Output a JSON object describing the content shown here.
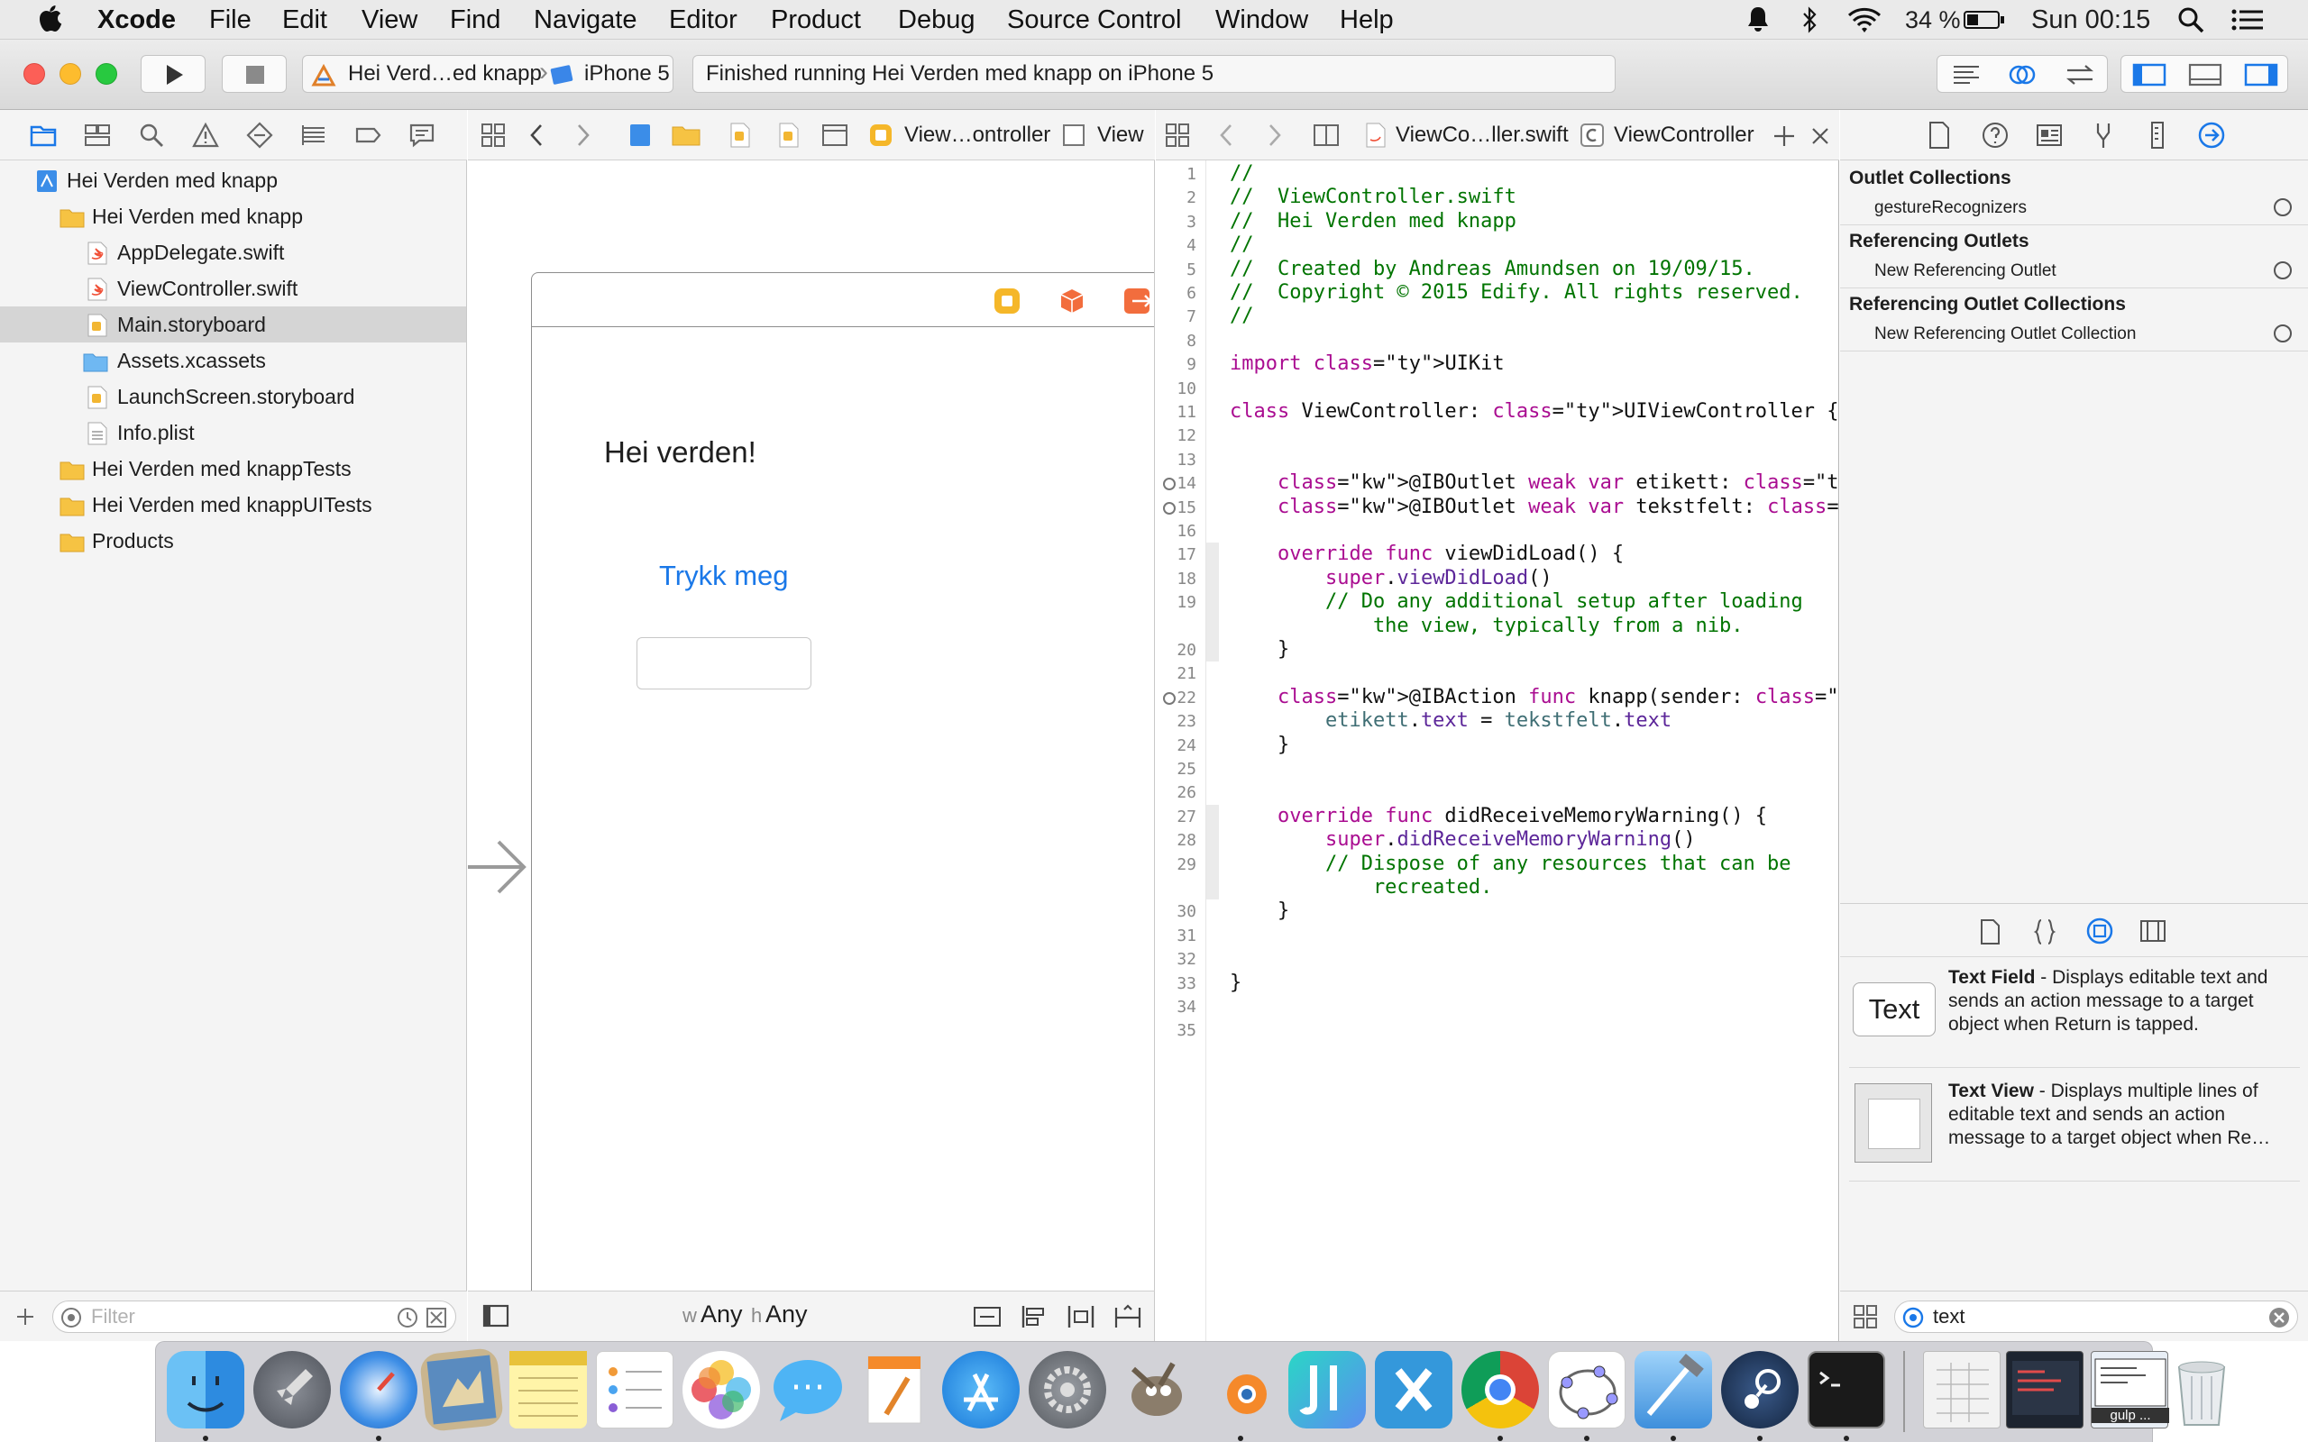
{
  "menubar": {
    "app_name": "Xcode",
    "items": [
      "File",
      "Edit",
      "View",
      "Find",
      "Navigate",
      "Editor",
      "Product",
      "Debug",
      "Source Control",
      "Window",
      "Help"
    ],
    "battery": "34 %",
    "clock": "Sun 00:15"
  },
  "toolbar": {
    "scheme_project": "Hei Verd…ed knapp",
    "scheme_device": "iPhone 5",
    "activity": "Finished running Hei Verden med knapp on iPhone 5"
  },
  "navigator": {
    "tree": [
      {
        "label": "Hei Verden med knapp",
        "icon": "project-icon"
      },
      {
        "label": "Hei Verden med knapp",
        "icon": "folder-icon"
      },
      {
        "label": "AppDelegate.swift",
        "icon": "swift-file-icon"
      },
      {
        "label": "ViewController.swift",
        "icon": "swift-file-icon"
      },
      {
        "label": "Main.storyboard",
        "icon": "storyboard-icon"
      },
      {
        "label": "Assets.xcassets",
        "icon": "assets-folder-icon"
      },
      {
        "label": "LaunchScreen.storyboard",
        "icon": "storyboard-icon"
      },
      {
        "label": "Info.plist",
        "icon": "plist-icon"
      },
      {
        "label": "Hei Verden med knappTests",
        "icon": "folder-icon"
      },
      {
        "label": "Hei Verden med knappUITests",
        "icon": "folder-icon"
      },
      {
        "label": "Products",
        "icon": "folder-icon"
      }
    ],
    "filter_placeholder": "Filter"
  },
  "storyboard": {
    "jump_scene": "View…ontroller",
    "jump_view": "View",
    "label_text": "Hei verden!",
    "button_text": "Trykk meg",
    "size_w_prefix": "w",
    "size_w": "Any",
    "size_h_prefix": "h",
    "size_h": "Any"
  },
  "editor": {
    "jump_file": "ViewCo…ller.swift",
    "jump_symbol": "ViewController",
    "line_numbers": [
      1,
      2,
      3,
      4,
      5,
      6,
      7,
      8,
      9,
      10,
      11,
      12,
      13,
      14,
      15,
      16,
      17,
      18,
      19,
      "",
      20,
      21,
      22,
      23,
      24,
      25,
      26,
      27,
      28,
      29,
      "",
      30,
      31,
      32,
      33,
      34,
      35
    ],
    "lines": [
      {
        "t": "//",
        "c": "cm"
      },
      {
        "t": "//  ViewController.swift",
        "c": "cm"
      },
      {
        "t": "//  Hei Verden med knapp",
        "c": "cm"
      },
      {
        "t": "//",
        "c": "cm"
      },
      {
        "t": "//  Created by Andreas Amundsen on 19/09/15.",
        "c": "cm"
      },
      {
        "t": "//  Copyright © 2015 Edify. All rights reserved.",
        "c": "cm"
      },
      {
        "t": "//",
        "c": "cm"
      },
      {
        "t": "",
        "c": ""
      },
      {
        "t": "import UIKit",
        "c": "import"
      },
      {
        "t": "",
        "c": ""
      },
      {
        "t": "class ViewController: UIViewController {",
        "c": "class"
      },
      {
        "t": "",
        "c": ""
      },
      {
        "t": "",
        "c": ""
      },
      {
        "t": "    @IBOutlet weak var etikett: UILabel!",
        "c": "outlet1"
      },
      {
        "t": "    @IBOutlet weak var tekstfelt: UITextField!",
        "c": "outlet2"
      },
      {
        "t": "",
        "c": ""
      },
      {
        "t": "    override func viewDidLoad() {",
        "c": "func1"
      },
      {
        "t": "        super.viewDidLoad()",
        "c": "super1"
      },
      {
        "t": "        // Do any additional setup after loading",
        "c": "cm"
      },
      {
        "t": "            the view, typically from a nib.",
        "c": "cm"
      },
      {
        "t": "    }",
        "c": ""
      },
      {
        "t": "",
        "c": ""
      },
      {
        "t": "    @IBAction func knapp(sender: AnyObject) {",
        "c": "action"
      },
      {
        "t": "        etikett.text = tekstfelt.text",
        "c": "assign"
      },
      {
        "t": "    }",
        "c": ""
      },
      {
        "t": "",
        "c": ""
      },
      {
        "t": "",
        "c": ""
      },
      {
        "t": "    override func didReceiveMemoryWarning() {",
        "c": "func2"
      },
      {
        "t": "        super.didReceiveMemoryWarning()",
        "c": "super2"
      },
      {
        "t": "        // Dispose of any resources that can be",
        "c": "cm"
      },
      {
        "t": "            recreated.",
        "c": "cm"
      },
      {
        "t": "    }",
        "c": ""
      },
      {
        "t": "",
        "c": ""
      },
      {
        "t": "",
        "c": ""
      },
      {
        "t": "}",
        "c": ""
      },
      {
        "t": "",
        "c": ""
      },
      {
        "t": "",
        "c": ""
      }
    ]
  },
  "inspector": {
    "sections": [
      {
        "title": "Outlet Collections",
        "item": "gestureRecognizers"
      },
      {
        "title": "Referencing Outlets",
        "item": "New Referencing Outlet"
      },
      {
        "title": "Referencing Outlet Collections",
        "item": "New Referencing Outlet Collection"
      }
    ],
    "library": [
      {
        "name": "Text Field",
        "desc": " - Displays editable text and sends an action message to a target object when Return is tapped.",
        "thumb": "Text"
      },
      {
        "name": "Text View",
        "desc": " - Displays multiple lines of editable text and sends an action message to a target object when Re…",
        "thumb": ""
      }
    ],
    "library_search": "text"
  },
  "dock": {
    "apps": [
      "Finder",
      "Launchpad",
      "Safari",
      "Mail",
      "Notes",
      "Reminders",
      "Photos",
      "Messages",
      "Pages",
      "App Store",
      "System Preferences",
      "GIMP",
      "Blender",
      "JetBrains",
      "Xamarin",
      "Chrome",
      "GeoGebra",
      "Xcode",
      "Steam",
      "Terminal",
      "Document",
      "Screenshot",
      "Window",
      "Trash"
    ],
    "gulp_label": "gulp ..."
  },
  "colors": {
    "accent": "#1a78e8",
    "comment": "#007400",
    "keyword": "#aa0d91",
    "type": "#5c2699"
  }
}
